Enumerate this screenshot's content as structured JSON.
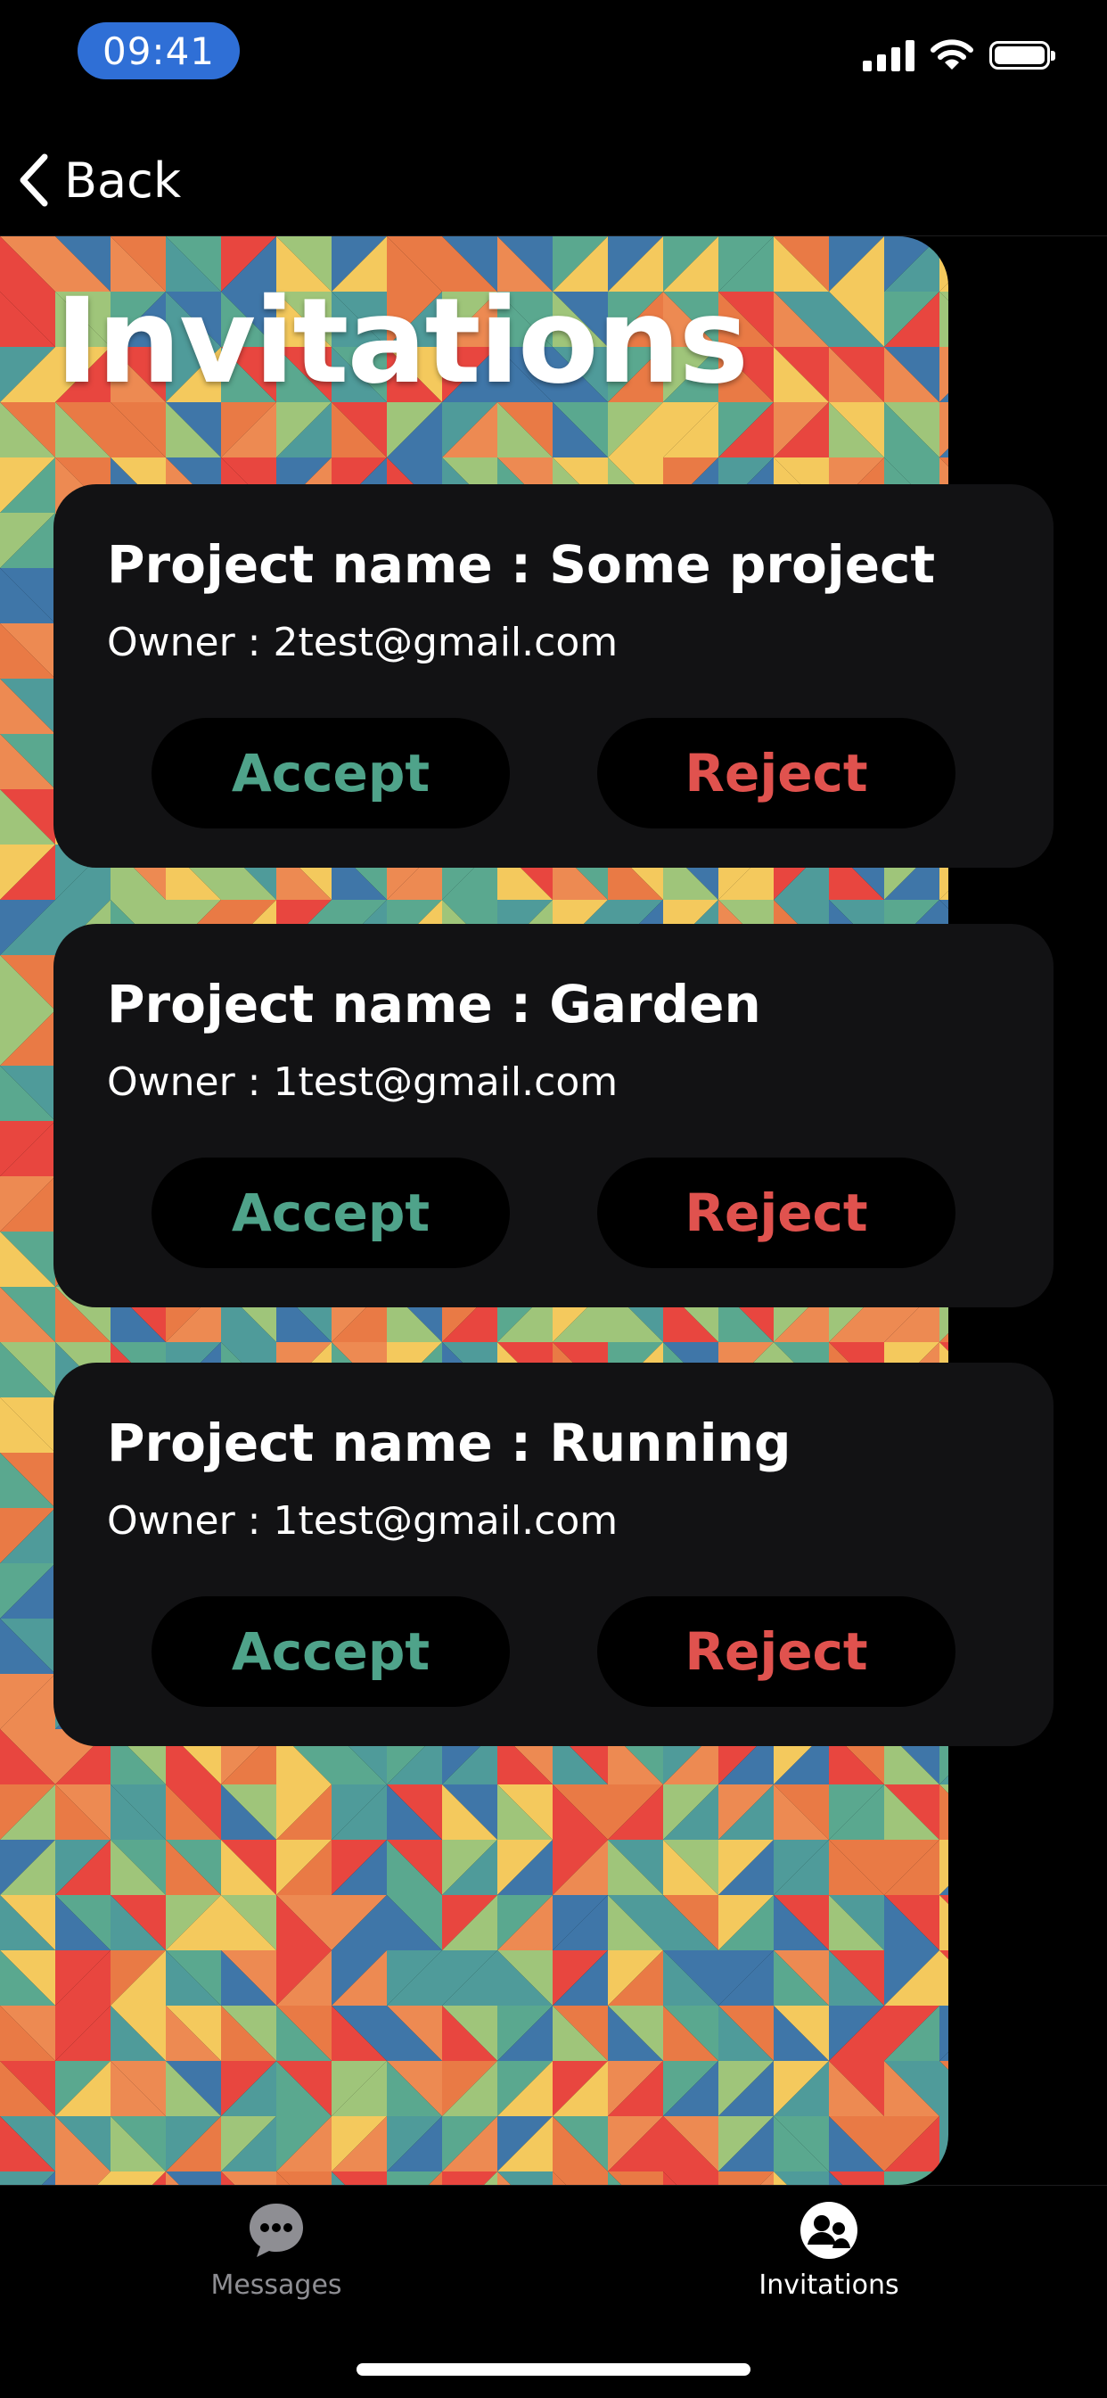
{
  "status_bar": {
    "time": "09:41",
    "icons": [
      "cellular-signal-icon",
      "wifi-icon",
      "battery-icon"
    ]
  },
  "nav": {
    "back_label": "Back",
    "back_icon": "chevron-left-icon"
  },
  "page": {
    "title": "Invitations"
  },
  "invitations": [
    {
      "project": "Project name : Some project",
      "owner": "Owner : 2test@gmail.com",
      "accept_label": "Accept",
      "reject_label": "Reject"
    },
    {
      "project": "Project name : Garden",
      "owner": "Owner : 1test@gmail.com",
      "accept_label": "Accept",
      "reject_label": "Reject"
    },
    {
      "project": "Project name : Running",
      "owner": "Owner : 1test@gmail.com",
      "accept_label": "Accept",
      "reject_label": "Reject"
    }
  ],
  "tab_bar": {
    "tabs": [
      {
        "label": "Messages",
        "icon": "chat-bubble-icon",
        "active": false
      },
      {
        "label": "Invitations",
        "icon": "people-icon",
        "active": true
      }
    ]
  },
  "colors": {
    "accept": "#4fa38a",
    "reject": "#e0524e",
    "card_background": "#121214",
    "time_pill": "#2f6fd6",
    "pattern": [
      "#e8463f",
      "#f4c95d",
      "#5aa88f",
      "#3f76a8",
      "#ed8a52",
      "#9fc57a",
      "#4f9b9a",
      "#e97a45"
    ]
  }
}
